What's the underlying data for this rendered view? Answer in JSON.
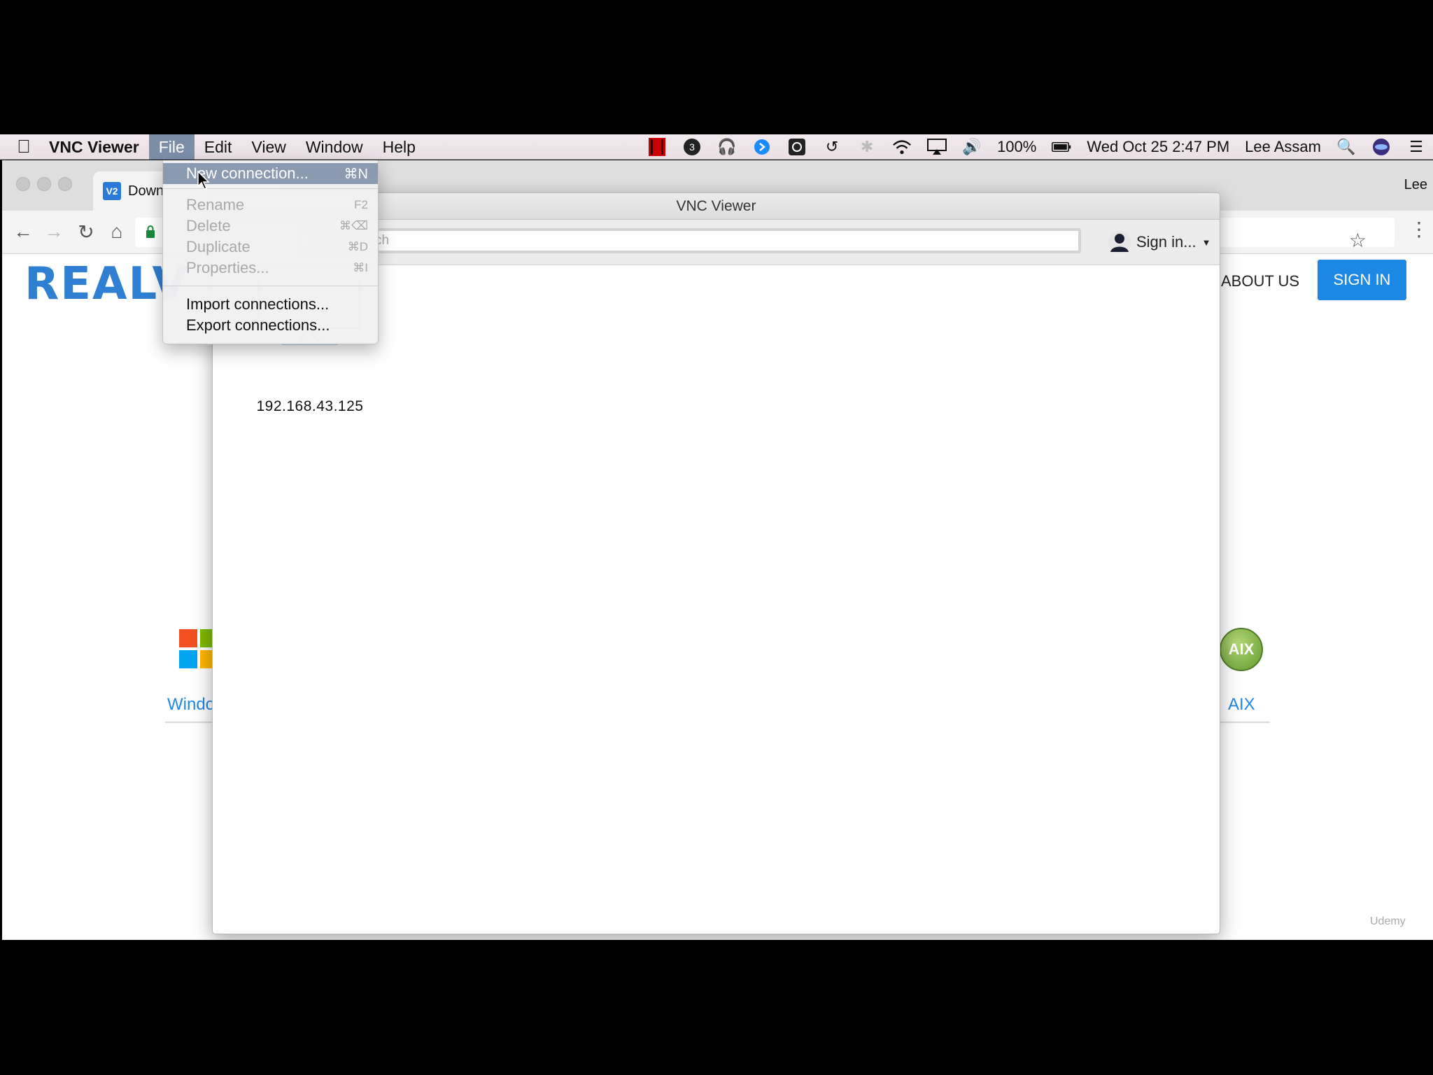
{
  "menubar": {
    "app_name": "VNC Viewer",
    "menus": [
      "File",
      "Edit",
      "View",
      "Window",
      "Help"
    ],
    "active_menu": "File",
    "status": {
      "battery": "100%",
      "datetime": "Wed Oct 25  2:47 PM",
      "user": "Lee Assam",
      "badge_count": "3"
    }
  },
  "file_menu": {
    "items": [
      {
        "label": "New connection...",
        "shortcut": "⌘N",
        "state": "highlighted"
      },
      {
        "label": "Rename",
        "shortcut": "F2",
        "state": "disabled"
      },
      {
        "label": "Delete",
        "shortcut": "⌘⌫",
        "state": "disabled"
      },
      {
        "label": "Duplicate",
        "shortcut": "⌘D",
        "state": "disabled"
      },
      {
        "label": "Properties...",
        "shortcut": "⌘I",
        "state": "disabled"
      },
      {
        "label": "Import connections...",
        "shortcut": "",
        "state": "enabled"
      },
      {
        "label": "Export connections...",
        "shortcut": "",
        "state": "enabled"
      }
    ]
  },
  "chrome": {
    "tab_title": "Down",
    "tab_favicon": "V2",
    "profile": "Lee"
  },
  "website": {
    "logo": "REALV",
    "nav_about": "ABOUT US",
    "sign_in": "SIGN IN",
    "os_left_label": "Windo",
    "os_right_label": "AIX",
    "aix_badge": "AIX"
  },
  "vnc": {
    "title": "VNC Viewer",
    "search_placeholder": "ess or search",
    "sign_in": "Sign in...",
    "connections": [
      {
        "label": "192.168.43.125"
      }
    ]
  },
  "watermark": "Udemy"
}
